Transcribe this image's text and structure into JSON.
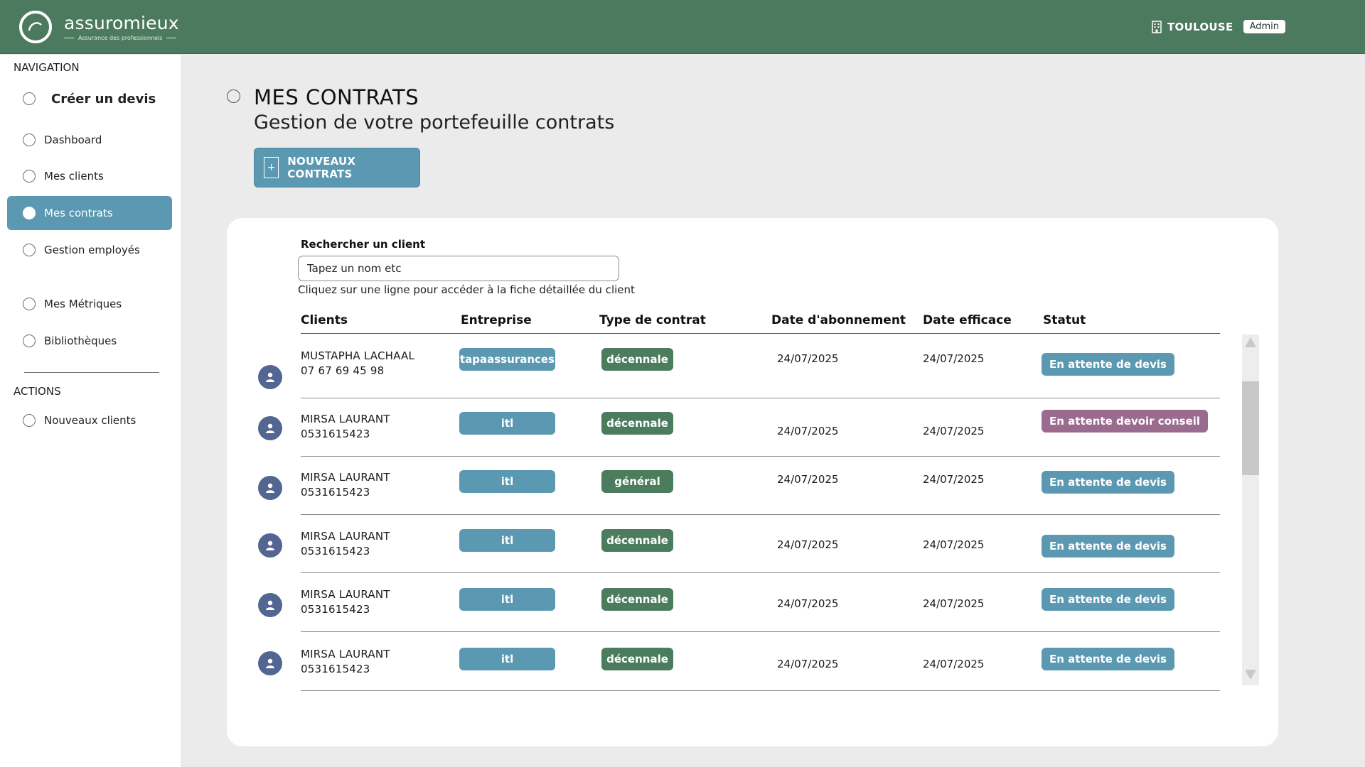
{
  "brand": {
    "name": "assuromieux",
    "tagline": "Assurance des professionnels"
  },
  "header": {
    "city": "TOULOUSE",
    "role": "Admin"
  },
  "sidebar": {
    "nav_heading": "NAVIGATION",
    "items": [
      {
        "label": "Créer un devis"
      },
      {
        "label": "Dashboard"
      },
      {
        "label": "Mes clients"
      },
      {
        "label": "Mes contrats"
      },
      {
        "label": "Gestion employés"
      },
      {
        "label": "Mes Métriques"
      },
      {
        "label": "Bibliothèques"
      }
    ],
    "actions_heading": "ACTIONS",
    "actions": [
      {
        "label": "Nouveaux clients"
      }
    ]
  },
  "page": {
    "title": "MES CONTRATS",
    "subtitle": "Gestion de votre portefeuille contrats",
    "new_button": "NOUVEAUX CONTRATS",
    "plus": "+"
  },
  "search": {
    "label": "Rechercher un client",
    "placeholder": "Tapez un nom etc",
    "hint": "Cliquez sur une ligne pour accéder à la fiche détaillée du client"
  },
  "table": {
    "headers": [
      "Clients",
      "Entreprise",
      "Type de contrat",
      "Date d'abonnement",
      "Date efficace",
      "Statut"
    ],
    "rows": [
      {
        "name": "MUSTAPHA LACHAAL",
        "phone": "07 67 69 45 98",
        "company": "tapaassurances",
        "contract": "décennale",
        "date_sub": "24/07/2025",
        "date_eff": "24/07/2025",
        "status": "En attente de devis"
      },
      {
        "name": "MIRSA LAURANT",
        "phone": "0531615423",
        "company": "itl",
        "contract": "décennale",
        "date_sub": "24/07/2025",
        "date_eff": "24/07/2025",
        "status": "En attente devoir conseil"
      },
      {
        "name": "MIRSA LAURANT",
        "phone": "0531615423",
        "company": "itl",
        "contract": "général",
        "date_sub": "24/07/2025",
        "date_eff": "24/07/2025",
        "status": "En attente de devis"
      },
      {
        "name": "MIRSA LAURANT",
        "phone": "0531615423",
        "company": "itl",
        "contract": "décennale",
        "date_sub": "24/07/2025",
        "date_eff": "24/07/2025",
        "status": "En attente de devis"
      },
      {
        "name": "MIRSA LAURANT",
        "phone": "0531615423",
        "company": "itl",
        "contract": "décennale",
        "date_sub": "24/07/2025",
        "date_eff": "24/07/2025",
        "status": "En attente de devis"
      },
      {
        "name": "MIRSA LAURANT",
        "phone": "0531615423",
        "company": "itl",
        "contract": "décennale",
        "date_sub": "24/07/2025",
        "date_eff": "24/07/2025",
        "status": "En attente de devis"
      }
    ]
  },
  "colors": {
    "header": "#4c7a5f",
    "accent_blue": "#5b98b1",
    "contract_green": "#4b7c5e",
    "status_blue": "#5b98b1",
    "status_mauve": "#9b6a8f",
    "avatar": "#536591"
  },
  "icons": [
    "logo-swirl-icon",
    "building-icon",
    "user-avatar-icon",
    "plus-icon",
    "scroll-up-icon",
    "scroll-down-icon"
  ]
}
